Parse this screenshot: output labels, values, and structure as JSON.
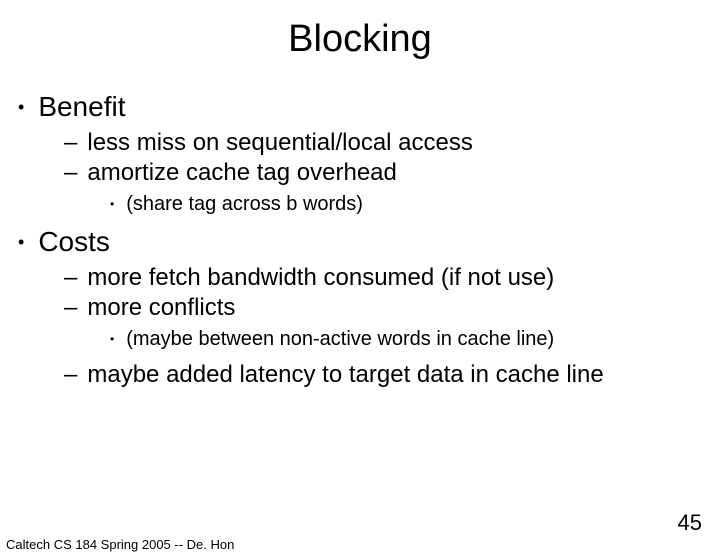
{
  "title": "Blocking",
  "bullets": {
    "benefit": {
      "label": "Benefit",
      "sub": [
        "less miss on sequential/local access",
        "amortize cache tag overhead"
      ],
      "subsub": "(share tag across b words)"
    },
    "costs": {
      "label": "Costs",
      "sub": [
        "more fetch bandwidth consumed (if not use)",
        "more conflicts"
      ],
      "subsub": "(maybe between non-active words in cache line)",
      "sub3": "maybe added latency to target data in cache line"
    }
  },
  "footer": "Caltech CS 184 Spring 2005 -- De. Hon",
  "page": "45"
}
